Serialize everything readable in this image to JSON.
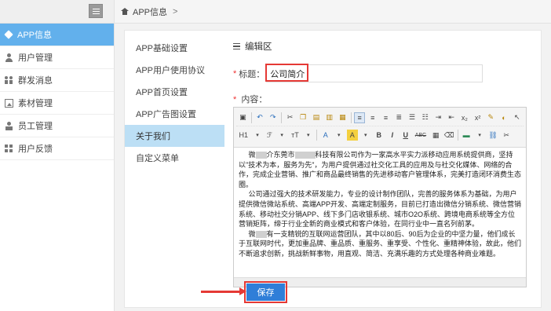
{
  "sidebar": {
    "items": [
      {
        "label": "APP信息",
        "icon": "app-icon",
        "active": true
      },
      {
        "label": "用户管理",
        "icon": "user-icon"
      },
      {
        "label": "群发消息",
        "icon": "group-icon"
      },
      {
        "label": "素材管理",
        "icon": "image-icon"
      },
      {
        "label": "员工管理",
        "icon": "staff-icon"
      },
      {
        "label": "用户反馈",
        "icon": "grid-icon"
      }
    ]
  },
  "breadcrumb": {
    "current": "APP信息",
    "sep": ">"
  },
  "subnav": {
    "items": [
      {
        "label": "APP基础设置"
      },
      {
        "label": "APP用户使用协议"
      },
      {
        "label": "APP首页设置"
      },
      {
        "label": "APP广告图设置"
      },
      {
        "label": "关于我们",
        "active": true
      },
      {
        "label": "自定义菜单"
      }
    ]
  },
  "editor_section": {
    "title": "编辑区",
    "title_label": "标题：",
    "title_value": "公司简介",
    "content_label": "内容：",
    "required_mark": "*"
  },
  "toolbar": {
    "row2": {
      "heading": "H1",
      "font_family": "ℱ",
      "font_size": "тT",
      "font_color": "A",
      "highlight": "A",
      "bold": "B",
      "italic": "I",
      "underline": "U",
      "strike": "ABC"
    }
  },
  "document": {
    "p1a": "微",
    "p1b": "介东莞市",
    "p1c": "科技有限公司作为一家高水平实力派移动应用系统提供商，坚持以\"技术为本，服务为先\"，为用户提供通过社交化工具的应用及与社交化媒体、网络的合作，完成企业营销、推广和商品最终销售的先进移动客户管理体系，完美打造闭环消费生态圈。",
    "p2": "公司通过强大的技术研发能力，专业的设计制作团队，完善的服务体系为基础，为用户提供微信微站系统、高端APP开发、高端定制服务，目前已打造出微信分销系统、微信营销系统、移动社交分销APP、线下多门店收银系统、城市O2O系统、跨境电商系统等全方位营销矩阵，缔于行业全新的商业模式和客户体验，在同行业中一直名列前茅。",
    "p3a": "微",
    "p3b": "有一支精锐的互联网运营团队，其中以80后、90后为企业的中坚力量，他们成长于互联网时代，更加重品牌、重品质、重服务、重享受、个性化、重精神体验，故此，他们不断追求创新，挑战新鲜事物，用直观、简洁、充满乐趣的方式处理各种商业难题。"
  },
  "actions": {
    "save_label": "保存"
  },
  "colors": {
    "sidebar_active": "#62b0ec",
    "subnav_active": "#bcdff5",
    "primary": "#2f7ed8",
    "annotation": "#e53935"
  }
}
